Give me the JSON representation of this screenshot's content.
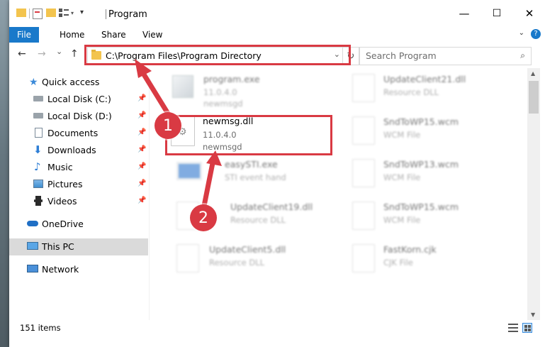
{
  "window": {
    "title": "Program",
    "controls": {
      "minimize": "—",
      "maximize": "☐",
      "close": "✕"
    }
  },
  "ribbon": {
    "tabs": [
      "File",
      "Home",
      "Share",
      "View"
    ],
    "help": "?"
  },
  "nav": {
    "back_icon": "←",
    "forward_icon": "→",
    "recent_icon": "⌄",
    "up_icon": "↑"
  },
  "address": {
    "path": "C:\\Program Files\\Program Directory",
    "dropdown": "⌄",
    "refresh": "↻"
  },
  "search": {
    "placeholder": "Search Program",
    "icon": "⌕"
  },
  "sidebar": {
    "items": [
      {
        "label": "Quick access",
        "icon": "star-icon",
        "pinned": false
      },
      {
        "label": "Local Disk (C:)",
        "icon": "drive-icon",
        "pinned": true
      },
      {
        "label": "Local Disk (D:)",
        "icon": "drive-icon",
        "pinned": true
      },
      {
        "label": "Documents",
        "icon": "documents-icon",
        "pinned": true
      },
      {
        "label": "Downloads",
        "icon": "downloads-icon",
        "pinned": true
      },
      {
        "label": "Music",
        "icon": "music-icon",
        "pinned": true
      },
      {
        "label": "Pictures",
        "icon": "pictures-icon",
        "pinned": true
      },
      {
        "label": "Videos",
        "icon": "videos-icon",
        "pinned": true
      },
      {
        "label": "OneDrive",
        "icon": "cloud-icon",
        "pinned": false
      },
      {
        "label": "This PC",
        "icon": "computer-icon",
        "pinned": false
      },
      {
        "label": "Network",
        "icon": "network-icon",
        "pinned": false
      }
    ],
    "pin_glyph": "📌"
  },
  "files": {
    "left": [
      {
        "name": "program.exe",
        "sub1": "11.0.4.0",
        "sub2": "newmsgd",
        "kind": "exe"
      },
      {
        "name": "newmsg.dll",
        "sub1": "11.0.4.0",
        "sub2": "newmsgd",
        "kind": "dll"
      },
      {
        "name": "easySTI.exe",
        "sub1": "STI event hand",
        "sub2": "",
        "kind": "app"
      },
      {
        "name": "UpdateClient19.dll",
        "sub1": "Resource DLL",
        "sub2": "",
        "kind": "dll"
      },
      {
        "name": "UpdateClient5.dll",
        "sub1": "Resource DLL",
        "sub2": "",
        "kind": "dll"
      }
    ],
    "right": [
      {
        "name": "UpdateClient21.dll",
        "sub1": "Resource DLL",
        "kind": "dll"
      },
      {
        "name": "SndToWP15.wcm",
        "sub1": "WCM File",
        "kind": "file"
      },
      {
        "name": "SndToWP13.wcm",
        "sub1": "WCM File",
        "kind": "file"
      },
      {
        "name": "SndToWP15.wcm",
        "sub1": "WCM File",
        "kind": "file"
      },
      {
        "name": "FastKorn.cjk",
        "sub1": "CJK File",
        "kind": "file"
      }
    ]
  },
  "status": {
    "count": "151 items"
  },
  "annotations": {
    "step1": "1",
    "step2": "2",
    "color": "#d93a43"
  },
  "colors": {
    "accent": "#1979ca",
    "highlight": "#d93a43",
    "folder": "#f3c44e"
  }
}
